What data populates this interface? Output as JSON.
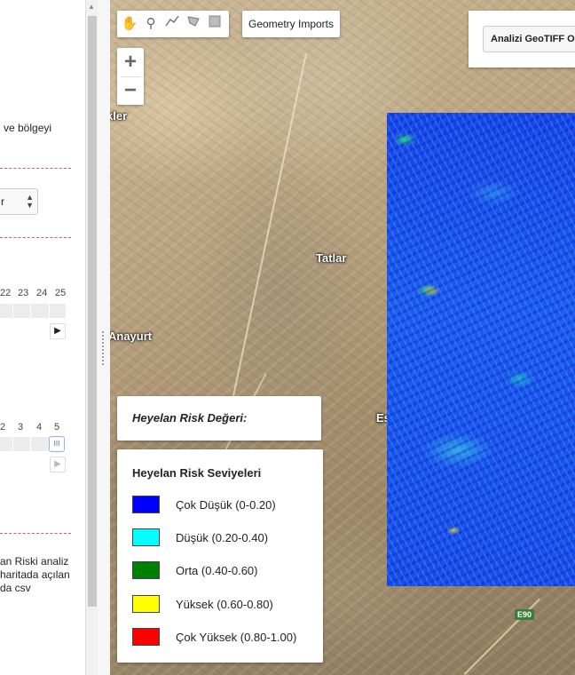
{
  "left_panel": {
    "text_lines": [
      {
        "text": "ve bölgeyi",
        "id": "intro-text"
      }
    ],
    "select_value": "r",
    "slider1": {
      "ticks": [
        "22",
        "23",
        "24",
        "25"
      ]
    },
    "slider2": {
      "ticks": [
        "2",
        "3",
        "4",
        "5"
      ],
      "handle_label": "III"
    },
    "bottom_text": [
      "an Riski analiz",
      "haritada açılan",
      "da csv"
    ]
  },
  "map": {
    "places": [
      "Tatlar",
      "Anayurt",
      "Es",
      "kler"
    ],
    "road_badge": "E90",
    "draw_tools": [
      "hand-icon",
      "point-icon",
      "line-icon",
      "polygon-icon",
      "rectangle-icon"
    ],
    "geometry_imports_label": "Geometry Imports",
    "zoom_in": "+",
    "zoom_out": "−",
    "export_button": "Analizi GeoTIFF Ol"
  },
  "risk_value_title": "Heyelan Risk Değeri:",
  "legend": {
    "title": "Heyelan Risk Seviyeleri",
    "items": [
      {
        "label": "Çok Düşük (0-0.20)",
        "color": "#0000ff"
      },
      {
        "label": "Düşük (0.20-0.40)",
        "color": "#00ffff"
      },
      {
        "label": "Orta (0.40-0.60)",
        "color": "#008000"
      },
      {
        "label": "Yüksek (0.60-0.80)",
        "color": "#ffff00"
      },
      {
        "label": "Çok Yüksek (0.80-1.00)",
        "color": "#ff0000"
      }
    ]
  }
}
